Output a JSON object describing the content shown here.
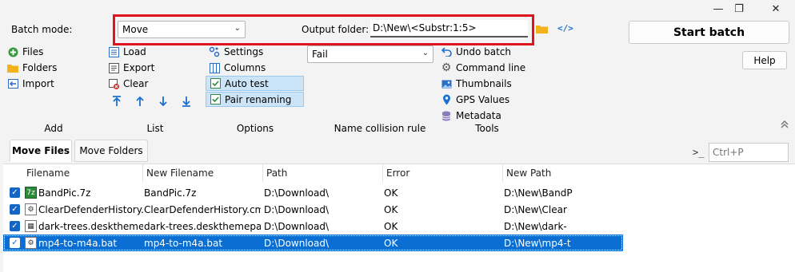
{
  "window": {
    "minimize_glyph": "—",
    "maximize_glyph": "❐",
    "close_glyph": "✕"
  },
  "batch": {
    "label": "Batch mode:",
    "mode": "Move",
    "output_label": "Output folder:",
    "output_value": "D:\\New\\<Substr:1:5>",
    "start_label": "Start batch",
    "help_label": "Help"
  },
  "add": {
    "files": "Files",
    "folders": "Folders",
    "import": "Import",
    "group": "Add"
  },
  "list": {
    "load": "Load",
    "export": "Export",
    "clear": "Clear",
    "group": "List"
  },
  "options": {
    "settings": "Settings",
    "columns": "Columns",
    "auto_test": "Auto test",
    "pair_renaming": "Pair renaming",
    "group": "Options"
  },
  "collision": {
    "value": "Fail",
    "group": "Name collision rule"
  },
  "tools": {
    "undo": "Undo batch",
    "command_line": "Command line",
    "thumbnails": "Thumbnails",
    "gps": "GPS Values",
    "metadata": "Metadata",
    "group": "Tools"
  },
  "tabs": [
    "Move Files",
    "Move Folders"
  ],
  "command": {
    "prompt": ">_",
    "placeholder": "Ctrl+P"
  },
  "table": {
    "headers": [
      "Filename",
      "New Filename",
      "Path",
      "Error",
      "New Path"
    ],
    "rows": [
      {
        "filename": "BandPic.7z",
        "new_filename": "BandPic.7z",
        "path": "D:\\Download\\",
        "error": "OK",
        "new_path": "D:\\New\\BandP",
        "icon": "7z"
      },
      {
        "filename": "ClearDefenderHistory.c...",
        "new_filename": "ClearDefenderHistory.cmd",
        "path": "D:\\Download\\",
        "error": "OK",
        "new_path": "D:\\New\\Clear",
        "icon": "cmd"
      },
      {
        "filename": "dark-trees.deskthemep...",
        "new_filename": "dark-trees.deskthemepack",
        "path": "D:\\Download\\",
        "error": "OK",
        "new_path": "D:\\New\\dark-",
        "icon": "pack"
      },
      {
        "filename": "mp4-to-m4a.bat",
        "new_filename": "mp4-to-m4a.bat",
        "path": "D:\\Download\\",
        "error": "OK",
        "new_path": "D:\\New\\mp4-t",
        "icon": "bat"
      }
    ]
  },
  "colors": {
    "highlight_red": "#e0141e",
    "selection_blue": "#0b6ed3",
    "option_active_bg": "#cce4f7"
  }
}
